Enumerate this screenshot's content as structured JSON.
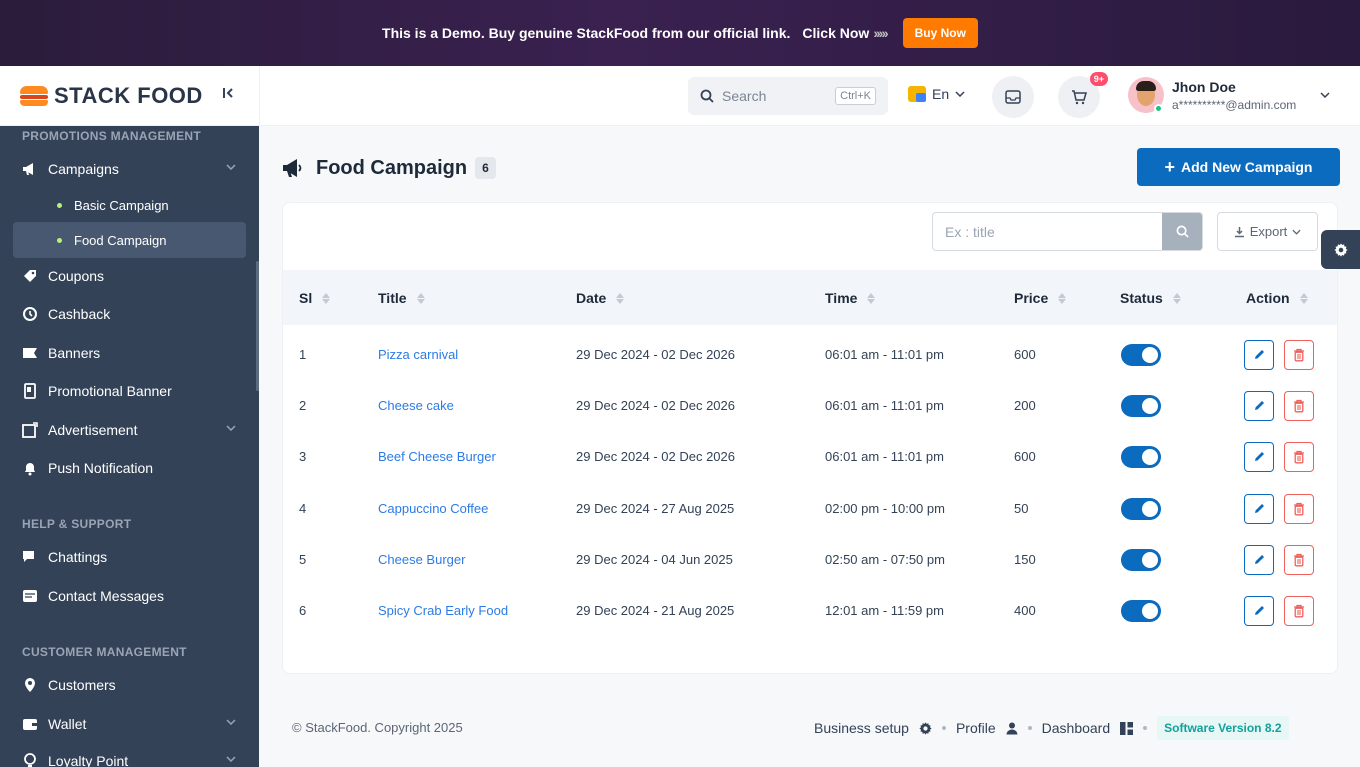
{
  "demo": {
    "text": "This is a Demo. Buy genuine StackFood from our official link.",
    "click_now": "Click Now",
    "arrows": "›››››",
    "buy_now": "Buy Now"
  },
  "header": {
    "logo_text": "STACK FOOD",
    "search_placeholder": "Search",
    "search_shortcut": "Ctrl+K",
    "language": "En",
    "cart_badge": "9+",
    "user_name": "Jhon Doe",
    "user_email": "a**********@admin.com"
  },
  "sidebar": {
    "section_promotions": "PROMOTIONS MANAGEMENT",
    "campaigns": "Campaigns",
    "basic_campaign": "Basic Campaign",
    "food_campaign": "Food Campaign",
    "coupons": "Coupons",
    "cashback": "Cashback",
    "banners": "Banners",
    "promotional_banner": "Promotional Banner",
    "advertisement": "Advertisement",
    "push_notification": "Push Notification",
    "section_help": "HELP & SUPPORT",
    "chattings": "Chattings",
    "contact_messages": "Contact Messages",
    "section_customer": "CUSTOMER MANAGEMENT",
    "customers": "Customers",
    "wallet": "Wallet",
    "loyalty_point": "Loyalty Point"
  },
  "page": {
    "title": "Food Campaign",
    "count": "6",
    "add_button": "Add New Campaign",
    "search_placeholder": "Ex : title",
    "export_label": "Export"
  },
  "table": {
    "headers": {
      "sl": "Sl",
      "title": "Title",
      "date": "Date",
      "time": "Time",
      "price": "Price",
      "status": "Status",
      "action": "Action"
    },
    "rows": [
      {
        "sl": "1",
        "title": "Pizza carnival",
        "date": "29 Dec 2024 - 02 Dec 2026",
        "time": "06:01 am - 11:01 pm",
        "price": "600",
        "status_on": true
      },
      {
        "sl": "2",
        "title": "Cheese cake",
        "date": "29 Dec 2024 - 02 Dec 2026",
        "time": "06:01 am - 11:01 pm",
        "price": "200",
        "status_on": true
      },
      {
        "sl": "3",
        "title": "Beef Cheese Burger",
        "date": "29 Dec 2024 - 02 Dec 2026",
        "time": "06:01 am - 11:01 pm",
        "price": "600",
        "status_on": true
      },
      {
        "sl": "4",
        "title": "Cappuccino Coffee",
        "date": "29 Dec 2024 - 27 Aug 2025",
        "time": "02:00 pm - 10:00 pm",
        "price": "50",
        "status_on": true
      },
      {
        "sl": "5",
        "title": "Cheese Burger",
        "date": "29 Dec 2024 - 04 Jun 2025",
        "time": "02:50 am - 07:50 pm",
        "price": "150",
        "status_on": true
      },
      {
        "sl": "6",
        "title": "Spicy Crab Early Food",
        "date": "29 Dec 2024 - 21 Aug 2025",
        "time": "12:01 am - 11:59 pm",
        "price": "400",
        "status_on": true
      }
    ]
  },
  "footer": {
    "copyright": "© StackFood. Copyright 2025",
    "business_setup": "Business setup",
    "profile": "Profile",
    "dashboard": "Dashboard",
    "version": "Software Version 8.2"
  },
  "colors": {
    "sidebar_bg": "#334257",
    "primary": "#0b6bbf",
    "link": "#2c7be5",
    "buy_now": "#ff7a00",
    "danger": "#f0605a"
  }
}
